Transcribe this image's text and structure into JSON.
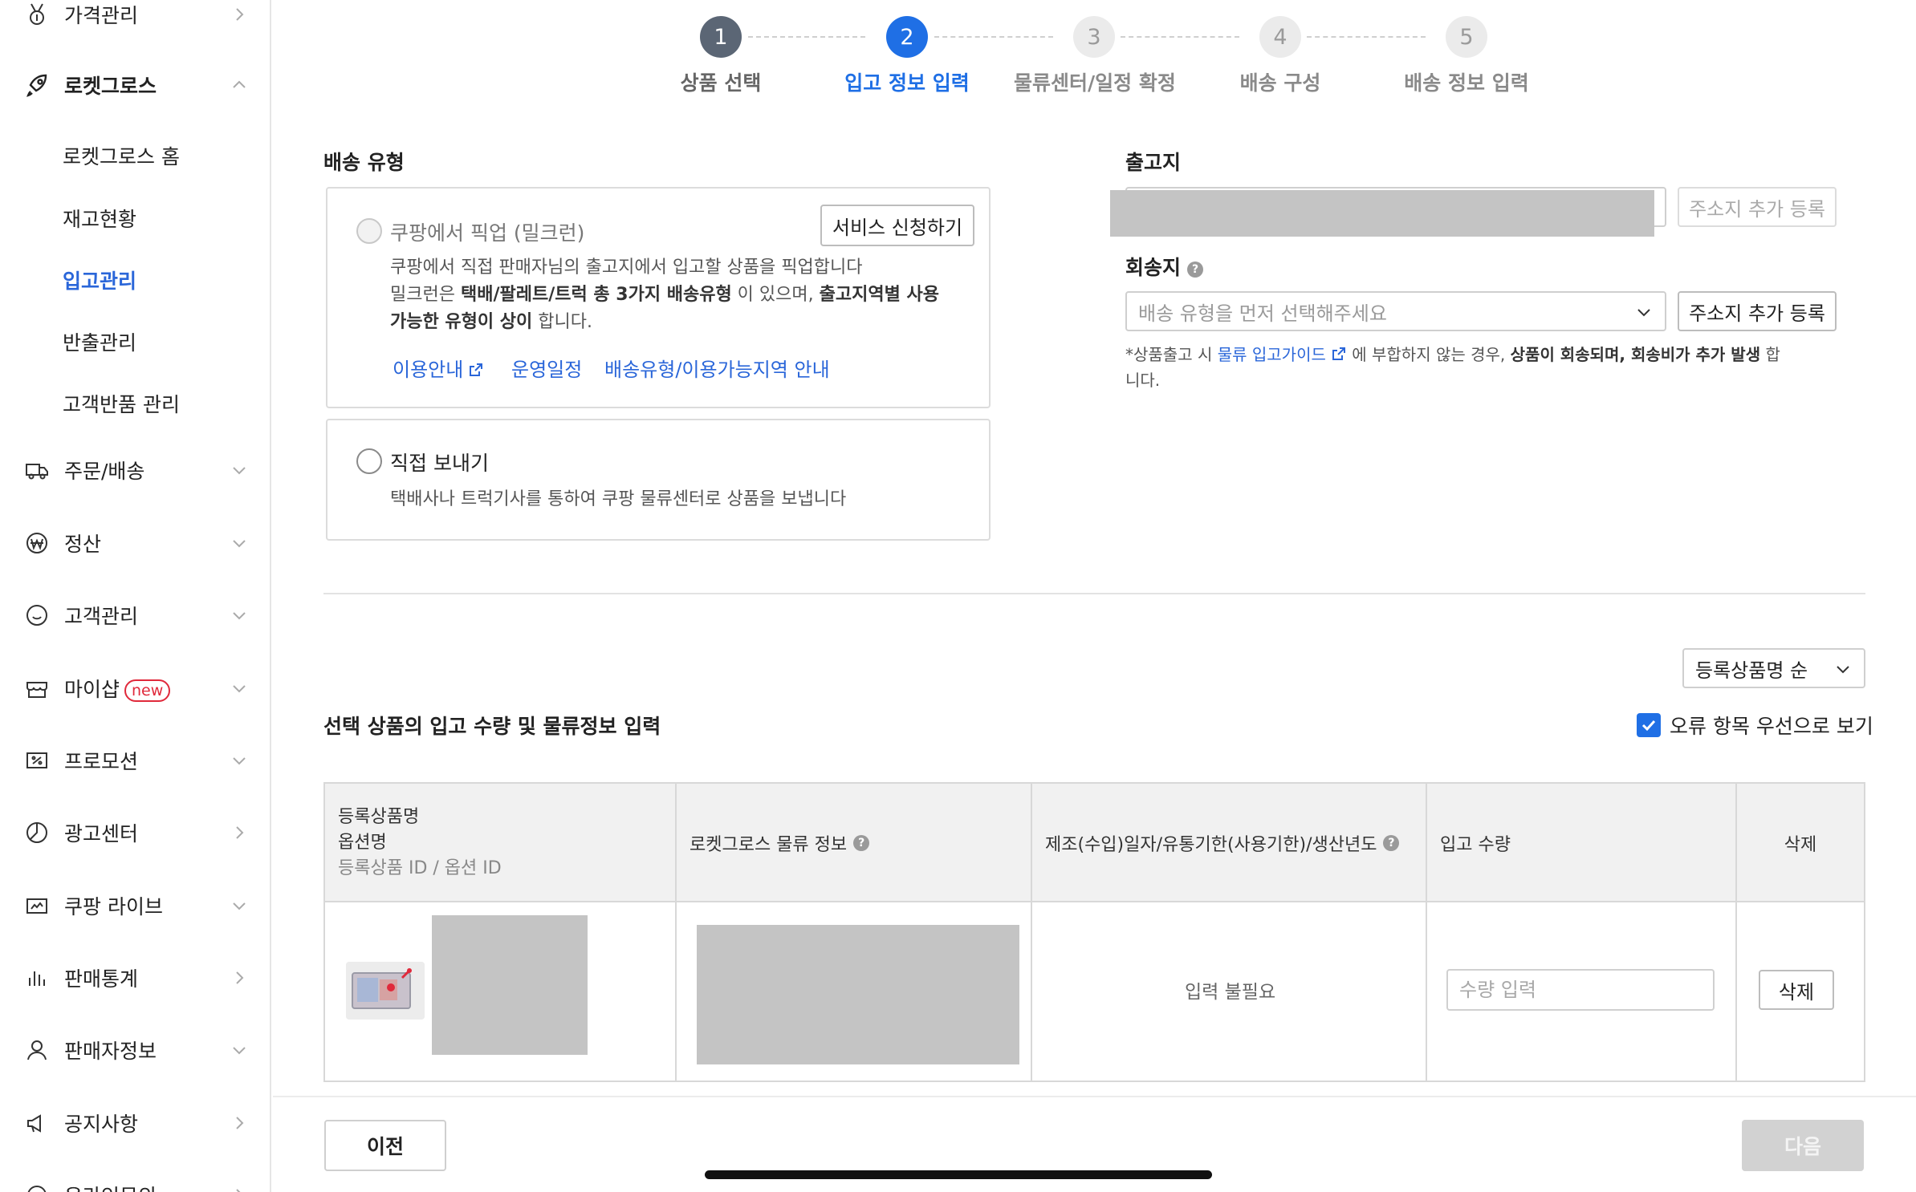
{
  "sidebar": {
    "items": [
      {
        "label": "가격관리",
        "icon": "medal-icon",
        "chevron": "right"
      },
      {
        "label": "로켓그로스",
        "icon": "rocket-icon",
        "chevron": "up"
      },
      {
        "label": "주문/배송",
        "icon": "truck-icon",
        "chevron": "down"
      },
      {
        "label": "정산",
        "icon": "won-icon",
        "chevron": "down"
      },
      {
        "label": "고객관리",
        "icon": "smile-icon",
        "chevron": "down"
      },
      {
        "label": "마이샵",
        "icon": "shop-icon",
        "chevron": "down",
        "badge": "new"
      },
      {
        "label": "프로모션",
        "icon": "coupon-icon",
        "chevron": "down"
      },
      {
        "label": "광고센터",
        "icon": "pie-icon",
        "chevron": "right"
      },
      {
        "label": "쿠팡 라이브",
        "icon": "live-icon",
        "chevron": "down"
      },
      {
        "label": "판매통계",
        "icon": "bar-chart-icon",
        "chevron": "right"
      },
      {
        "label": "판매자정보",
        "icon": "user-icon",
        "chevron": "down"
      },
      {
        "label": "공지사항",
        "icon": "megaphone-icon",
        "chevron": "right"
      },
      {
        "label": "온라인문의",
        "icon": "chat-icon",
        "chevron": "right"
      }
    ],
    "subitems": [
      {
        "label": "로켓그로스 홈",
        "active": false
      },
      {
        "label": "재고현황",
        "active": false
      },
      {
        "label": "입고관리",
        "active": true
      },
      {
        "label": "반출관리",
        "active": false
      },
      {
        "label": "고객반품 관리",
        "active": false
      }
    ]
  },
  "stepper": {
    "steps": [
      {
        "num": "1",
        "label": "상품 선택",
        "state": "done"
      },
      {
        "num": "2",
        "label": "입고 정보 입력",
        "state": "current"
      },
      {
        "num": "3",
        "label": "물류센터/일정 확정",
        "state": "todo"
      },
      {
        "num": "4",
        "label": "배송 구성",
        "state": "todo"
      },
      {
        "num": "5",
        "label": "배송 정보 입력",
        "state": "todo"
      }
    ]
  },
  "delivery": {
    "title": "배송 유형",
    "pickup": {
      "title": "쿠팡에서 픽업 (밀크런)",
      "service_button": "서비스 신청하기",
      "desc_line1": "쿠팡에서 직접 판매자님의 출고지에서 입고할 상품을 픽업합니다",
      "desc_line2_pre": "밀크런은 ",
      "desc_line2_bold": "택배/팔레트/트럭 총 3가지 배송유형",
      "desc_line2_mid": " 이 있으며, ",
      "desc_line2_bold2": "출고지역별 사용",
      "desc_line3_bold": "가능한 유형이 상이",
      "desc_line3_post": " 합니다.",
      "links": [
        "이용안내",
        "운영일정",
        "배송유형/이용가능지역 안내"
      ]
    },
    "direct": {
      "title": "직접 보내기",
      "desc": "택배사나 트럭기사를 통하여 쿠팡 물류센터로 상품을 보냅니다"
    }
  },
  "origin": {
    "title": "출고지",
    "add_button": "주소지 추가 등록"
  },
  "return_addr": {
    "title": "회송지",
    "placeholder": "배송 유형을 먼저 선택해주세요",
    "add_button": "주소지 추가 등록",
    "notice_pre": "*상품출고 시 ",
    "notice_link": "물류 입고가이드",
    "notice_mid": " 에 부합하지 않는 경우, ",
    "notice_bold": "상품이 회송되며, 회송비가 추가 발생",
    "notice_post": " 합니다."
  },
  "products": {
    "sort_label": "등록상품명 순",
    "section_title": "선택 상품의 입고 수량 및 물류정보 입력",
    "error_first_label": "오류 항목 우선으로 보기",
    "error_first_checked": true,
    "headers": {
      "name_line1": "등록상품명",
      "name_line2": "옵션명",
      "name_line3": "등록상품 ID / 옵션 ID",
      "logistics": "로켓그로스 물류 정보",
      "dates": "제조(수입)일자/유통기한(사용기한)/생산년도",
      "qty": "입고 수량",
      "delete": "삭제"
    },
    "rows": [
      {
        "dates_text": "입력 불필요",
        "qty_placeholder": "수량 입력",
        "delete_label": "삭제"
      }
    ]
  },
  "footer": {
    "prev": "이전",
    "next": "다음"
  },
  "colors": {
    "accent": "#1f6fe5",
    "active_nav": "#2a66d9",
    "badge": "#e0293b",
    "disabled_btn": "#d2d2d2"
  }
}
